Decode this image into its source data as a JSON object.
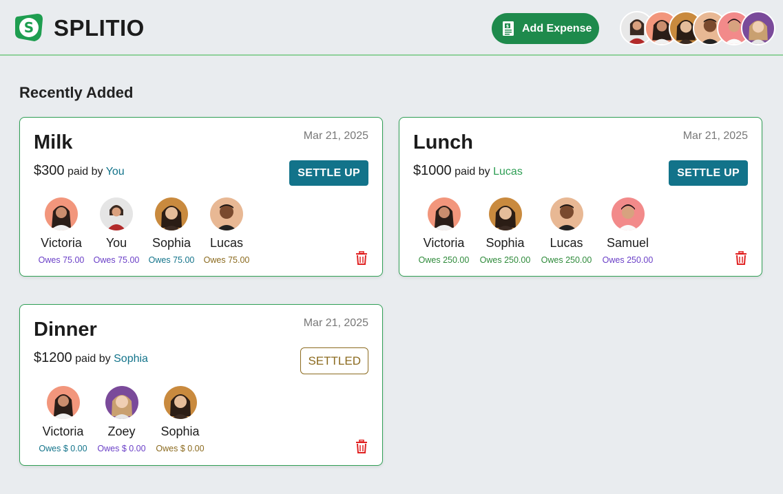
{
  "app": {
    "brand": "SPLITIO",
    "add_expense_label": "Add Expense",
    "accent": "#1e8a4c"
  },
  "header": {
    "avatars": [
      "avatar-1",
      "avatar-2",
      "avatar-3",
      "avatar-4",
      "avatar-5",
      "avatar-6"
    ]
  },
  "section": {
    "title": "Recently Added"
  },
  "expenses": [
    {
      "title": "Milk",
      "date": "Mar 21, 2025",
      "amount": "$300",
      "paid_by_text": "paid by",
      "payer": "You",
      "payer_color": "#12738a",
      "action": "SETTLE UP",
      "members": [
        {
          "name": "Victoria",
          "owes": "Owes 75.00",
          "owes_color": "#6a3fc7",
          "bg": "#f2967c"
        },
        {
          "name": "You",
          "owes": "Owes 75.00",
          "owes_color": "#6a3fc7",
          "bg": "#e5e5e5"
        },
        {
          "name": "Sophia",
          "owes": "Owes 75.00",
          "owes_color": "#12738a",
          "bg": "#c98a3e"
        },
        {
          "name": "Lucas",
          "owes": "Owes 75.00",
          "owes_color": "#8b6a1e",
          "bg": "#e8b894"
        }
      ]
    },
    {
      "title": "Lunch",
      "date": "Mar 21, 2025",
      "amount": "$1000",
      "paid_by_text": "paid by",
      "payer": "Lucas",
      "payer_color": "#2e9e54",
      "action": "SETTLE UP",
      "members": [
        {
          "name": "Victoria",
          "owes": "Owes 250.00",
          "owes_color": "#2e8a3a",
          "bg": "#f2967c"
        },
        {
          "name": "Sophia",
          "owes": "Owes 250.00",
          "owes_color": "#2e8a3a",
          "bg": "#c98a3e"
        },
        {
          "name": "Lucas",
          "owes": "Owes 250.00",
          "owes_color": "#2e8a3a",
          "bg": "#e8b894"
        },
        {
          "name": "Samuel",
          "owes": "Owes 250.00",
          "owes_color": "#6a3fc7",
          "bg": "#f28a8a"
        }
      ]
    },
    {
      "title": "Dinner",
      "date": "Mar 21, 2025",
      "amount": "$1200",
      "paid_by_text": "paid by",
      "payer": "Sophia",
      "payer_color": "#12738a",
      "action": "SETTLED",
      "members": [
        {
          "name": "Victoria",
          "owes": "Owes $ 0.00",
          "owes_color": "#12738a",
          "bg": "#f2967c"
        },
        {
          "name": "Zoey",
          "owes": "Owes $ 0.00",
          "owes_color": "#6a3fc7",
          "bg": "#7a4a9a"
        },
        {
          "name": "Sophia",
          "owes": "Owes $ 0.00",
          "owes_color": "#8b6a1e",
          "bg": "#c98a3e"
        }
      ]
    }
  ]
}
